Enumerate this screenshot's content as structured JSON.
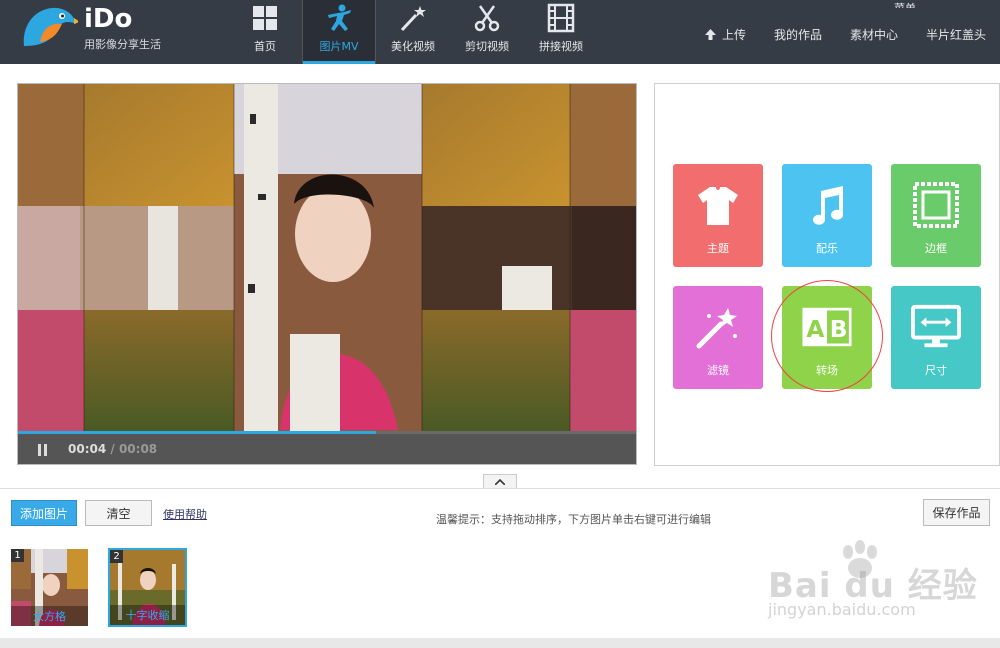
{
  "app": {
    "logo_text": "iDo",
    "logo_sub": "用影像分享生活"
  },
  "nav": {
    "items": [
      {
        "label": "首页",
        "icon": "grid-icon",
        "active": false
      },
      {
        "label": "图片MV",
        "icon": "dancer-icon",
        "active": true
      },
      {
        "label": "美化视频",
        "icon": "magic-wand-icon",
        "active": false
      },
      {
        "label": "剪切视频",
        "icon": "scissors-icon",
        "active": false
      },
      {
        "label": "拼接视频",
        "icon": "film-strip-icon",
        "active": false
      }
    ]
  },
  "topright": {
    "partial_text": "菜单",
    "upload": "上传",
    "my_works": "我的作品",
    "materials": "素材中心",
    "studio": "半片红盖头"
  },
  "player": {
    "current_time": "00:04",
    "separator": " / ",
    "total_time": "00:08",
    "progress_fraction": 0.58
  },
  "tools": {
    "tiles": [
      {
        "label": "主题",
        "icon": "tshirt-icon",
        "color": "#f26d6d"
      },
      {
        "label": "配乐",
        "icon": "music-note-icon",
        "color": "#4dc3f2"
      },
      {
        "label": "边框",
        "icon": "frame-icon",
        "color": "#6acb6b"
      },
      {
        "label": "滤镜",
        "icon": "magic-wand-icon",
        "color": "#e270d6"
      },
      {
        "label": "转场",
        "icon": "ab-transition-icon",
        "color": "#8fd34a"
      },
      {
        "label": "尺寸",
        "icon": "monitor-resize-icon",
        "color": "#46c8c6"
      }
    ]
  },
  "bottom": {
    "add_button": "添加图片",
    "clear_button": "清空",
    "help_link": "使用帮助",
    "tip": "温馨提示：支持拖动排序，下方图片单击右键可进行编辑",
    "save_button": "保存作品",
    "thumbs": [
      {
        "num": "1",
        "caption": "大方格"
      },
      {
        "num": "2",
        "caption": "十字收缩"
      }
    ]
  },
  "watermark": {
    "text": "Bai du 经验",
    "url": "jingyan.baidu.com"
  },
  "colors": {
    "topbar": "#363c46",
    "accent": "#2ea7e0"
  }
}
